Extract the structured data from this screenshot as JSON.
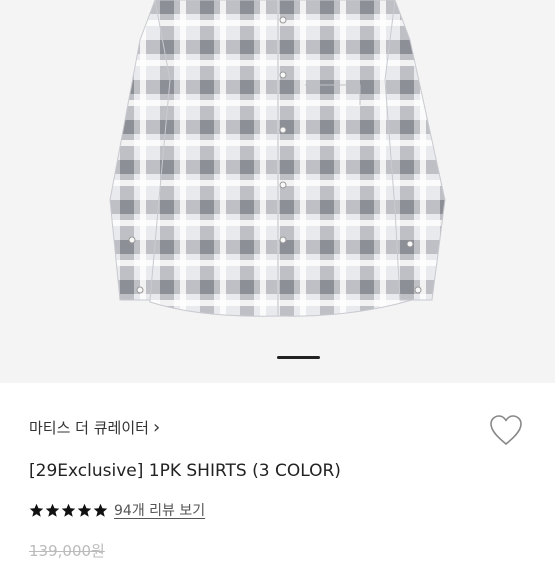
{
  "product": {
    "brand_label": "마티스 더 큐레이터",
    "brand_chevron": "›",
    "title": "[29Exclusive] 1PK SHIRTS (3 COLOR)",
    "rating_stars": 5,
    "review_link": "94개 리뷰 보기",
    "original_price": "139,000원"
  },
  "gallery": {
    "active_index": 0,
    "image_alt": "plaid shirt"
  },
  "colors": {
    "gallery_bg": "#f4f4f4",
    "shirt_dark": "#8a8d96",
    "shirt_light": "#ffffff",
    "star": "#111111",
    "text": "#222222",
    "muted": "#bbbbbb"
  },
  "icons": {
    "wishlist": "heart-outline-icon",
    "star": "star-icon",
    "chevron": "chevron-right-icon"
  }
}
